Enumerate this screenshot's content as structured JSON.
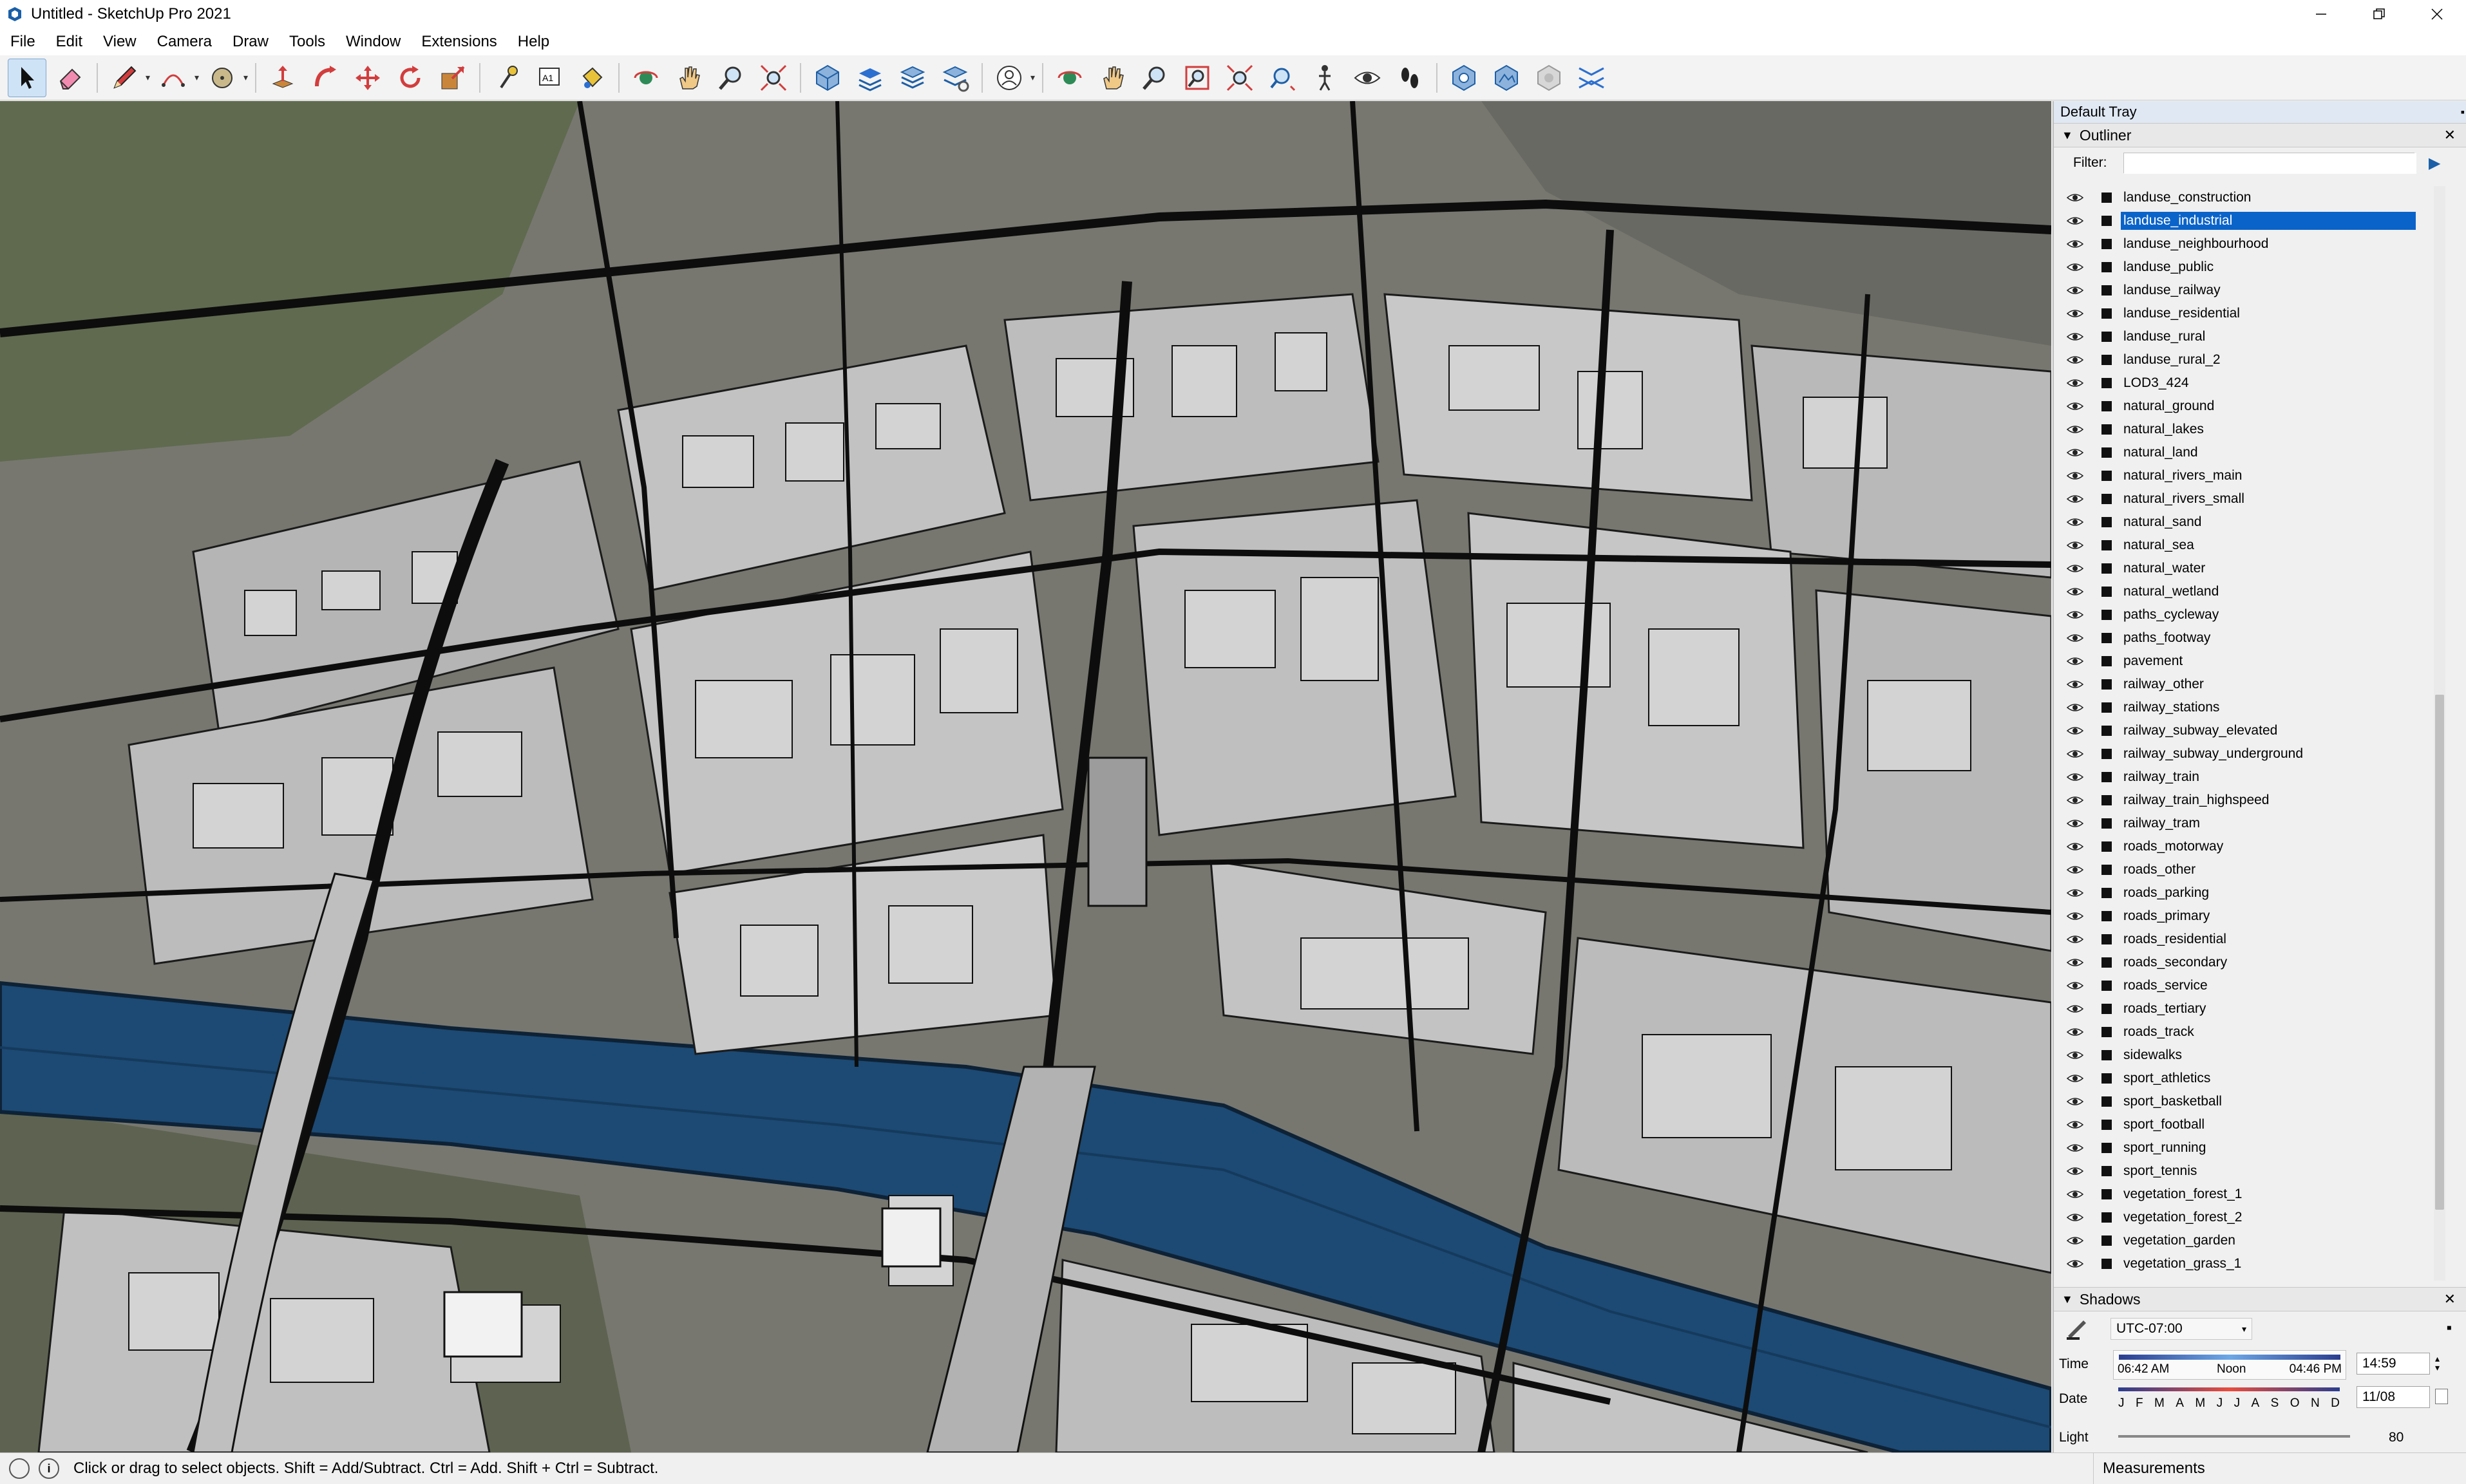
{
  "window": {
    "title": "Untitled - SketchUp Pro 2021",
    "controls": [
      "minimize-icon",
      "maximize-icon",
      "close-icon"
    ]
  },
  "menu": [
    "File",
    "Edit",
    "View",
    "Camera",
    "Draw",
    "Tools",
    "Window",
    "Extensions",
    "Help"
  ],
  "toolbar": {
    "tools": [
      "select",
      "eraser",
      "line",
      "arc",
      "shape",
      "push-pull",
      "follow-me",
      "move",
      "rotate",
      "scale",
      "tape-measure",
      "text",
      "paint-bucket",
      "orbit",
      "pan",
      "zoom",
      "zoom-extents",
      "iso-view",
      "top-view",
      "front-view",
      "section-plane",
      "profile",
      "position-camera",
      "walk",
      "look-around",
      "zoom-window",
      "previous-view",
      "next-view",
      "add-location",
      "terrain",
      "photo-textures",
      "sandbox"
    ],
    "text_tool_label": "A1"
  },
  "tray": {
    "title": "Default Tray",
    "outliner": {
      "title": "Outliner",
      "filter_label": "Filter:",
      "filter_value": "",
      "items": [
        {
          "name": "landuse_construction",
          "selected": false
        },
        {
          "name": "landuse_industrial",
          "selected": true
        },
        {
          "name": "landuse_neighbourhood",
          "selected": false
        },
        {
          "name": "landuse_public",
          "selected": false
        },
        {
          "name": "landuse_railway",
          "selected": false
        },
        {
          "name": "landuse_residential",
          "selected": false
        },
        {
          "name": "landuse_rural",
          "selected": false
        },
        {
          "name": "landuse_rural_2",
          "selected": false
        },
        {
          "name": "LOD3_424",
          "selected": false
        },
        {
          "name": "natural_ground",
          "selected": false
        },
        {
          "name": "natural_lakes",
          "selected": false
        },
        {
          "name": "natural_land",
          "selected": false
        },
        {
          "name": "natural_rivers_main",
          "selected": false
        },
        {
          "name": "natural_rivers_small",
          "selected": false
        },
        {
          "name": "natural_sand",
          "selected": false
        },
        {
          "name": "natural_sea",
          "selected": false
        },
        {
          "name": "natural_water",
          "selected": false
        },
        {
          "name": "natural_wetland",
          "selected": false
        },
        {
          "name": "paths_cycleway",
          "selected": false
        },
        {
          "name": "paths_footway",
          "selected": false
        },
        {
          "name": "pavement",
          "selected": false
        },
        {
          "name": "railway_other",
          "selected": false
        },
        {
          "name": "railway_stations",
          "selected": false
        },
        {
          "name": "railway_subway_elevated",
          "selected": false
        },
        {
          "name": "railway_subway_underground",
          "selected": false
        },
        {
          "name": "railway_train",
          "selected": false
        },
        {
          "name": "railway_train_highspeed",
          "selected": false
        },
        {
          "name": "railway_tram",
          "selected": false
        },
        {
          "name": "roads_motorway",
          "selected": false
        },
        {
          "name": "roads_other",
          "selected": false
        },
        {
          "name": "roads_parking",
          "selected": false
        },
        {
          "name": "roads_primary",
          "selected": false
        },
        {
          "name": "roads_residential",
          "selected": false
        },
        {
          "name": "roads_secondary",
          "selected": false
        },
        {
          "name": "roads_service",
          "selected": false
        },
        {
          "name": "roads_tertiary",
          "selected": false
        },
        {
          "name": "roads_track",
          "selected": false
        },
        {
          "name": "sidewalks",
          "selected": false
        },
        {
          "name": "sport_athletics",
          "selected": false
        },
        {
          "name": "sport_basketball",
          "selected": false
        },
        {
          "name": "sport_football",
          "selected": false
        },
        {
          "name": "sport_running",
          "selected": false
        },
        {
          "name": "sport_tennis",
          "selected": false
        },
        {
          "name": "vegetation_forest_1",
          "selected": false
        },
        {
          "name": "vegetation_forest_2",
          "selected": false
        },
        {
          "name": "vegetation_garden",
          "selected": false
        },
        {
          "name": "vegetation_grass_1",
          "selected": false
        }
      ]
    },
    "shadows": {
      "title": "Shadows",
      "timezone": "UTC-07:00",
      "time_label": "Time",
      "time_start": "06:42 AM",
      "time_noon": "Noon",
      "time_end": "04:46 PM",
      "time_value": "14:59",
      "date_label": "Date",
      "months": [
        "J",
        "F",
        "M",
        "A",
        "M",
        "J",
        "J",
        "A",
        "S",
        "O",
        "N",
        "D"
      ],
      "date_value": "11/08",
      "light_label": "Light",
      "light_value": "80"
    }
  },
  "status": {
    "info_icon": "info-icon",
    "message": "Click or drag to select objects. Shift = Add/Subtract. Ctrl = Add. Shift + Ctrl = Subtract.",
    "measurements_label": "Measurements"
  },
  "colors": {
    "selection": "#0a63c9",
    "river": "#1c4a74",
    "building": "#c6c6c6",
    "ground": "#6f6f66"
  }
}
